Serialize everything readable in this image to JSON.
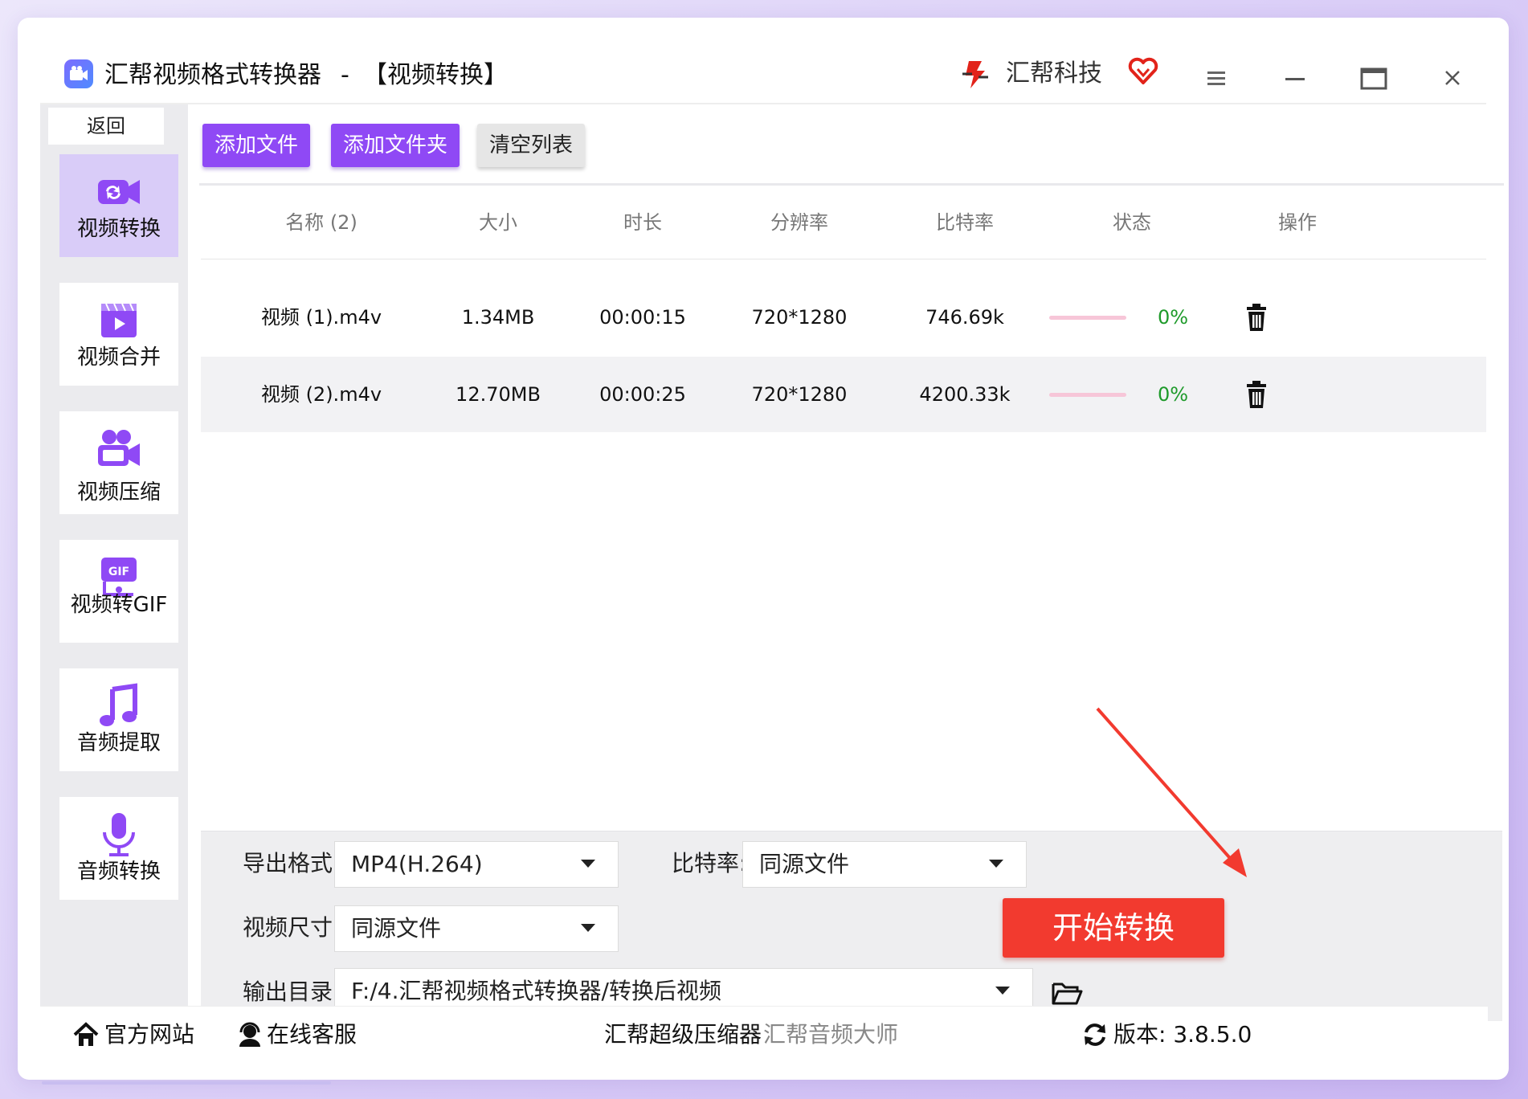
{
  "window": {
    "app_title": "汇帮视频格式转换器",
    "title_separator": "-",
    "section_title": "【视频转换】",
    "brand_name": "汇帮科技",
    "controls": {
      "menu": "menu-icon",
      "minimize": "minimize-icon",
      "maximize": "maximize-icon",
      "close": "close-icon"
    }
  },
  "sidebar": {
    "back_label": "返回",
    "items": [
      {
        "label": "视频转换",
        "icon": "video-convert-icon",
        "active": true
      },
      {
        "label": "视频合并",
        "icon": "video-merge-icon",
        "active": false
      },
      {
        "label": "视频压缩",
        "icon": "video-compress-icon",
        "active": false
      },
      {
        "label": "视频转GIF",
        "icon": "gif-icon",
        "active": false
      },
      {
        "label": "音频提取",
        "icon": "music-note-icon",
        "active": false
      },
      {
        "label": "音频转换",
        "icon": "microphone-icon",
        "active": false
      }
    ]
  },
  "toolbar": {
    "add_file": "添加文件",
    "add_folder": "添加文件夹",
    "clear_list": "清空列表"
  },
  "table": {
    "headers": [
      "名称 (2)",
      "大小",
      "时长",
      "分辨率",
      "比特率",
      "状态",
      "操作"
    ],
    "rows": [
      {
        "name": "视频 (1).m4v",
        "size": "1.34MB",
        "duration": "00:00:15",
        "resolution": "720*1280",
        "bitrate": "746.69k",
        "progress": 0,
        "progress_text": "0%"
      },
      {
        "name": "视频 (2).m4v",
        "size": "12.70MB",
        "duration": "00:00:25",
        "resolution": "720*1280",
        "bitrate": "4200.33k",
        "progress": 0,
        "progress_text": "0%"
      }
    ]
  },
  "settings": {
    "format_label": "导出格式:",
    "format_value": "MP4(H.264)",
    "bitrate_label": "比特率:",
    "bitrate_value": "同源文件",
    "size_label": "视频尺寸:",
    "size_value": "同源文件",
    "output_label": "输出目录:",
    "output_value": "F:/4.汇帮视频格式转换器/转换后视频"
  },
  "start_button": "开始转换",
  "footer": {
    "website": "官方网站",
    "support": "在线客服",
    "compressor": "汇帮超级压缩器",
    "audio_master": "汇帮音频大师",
    "version": "版本:  3.8.5.0"
  },
  "colors": {
    "accent": "#8f49f5",
    "active_sidebar": "#d9ccf8",
    "start": "#f23a2f",
    "progress_green": "#1e9a2a",
    "progress_track": "#f7c6d8"
  }
}
